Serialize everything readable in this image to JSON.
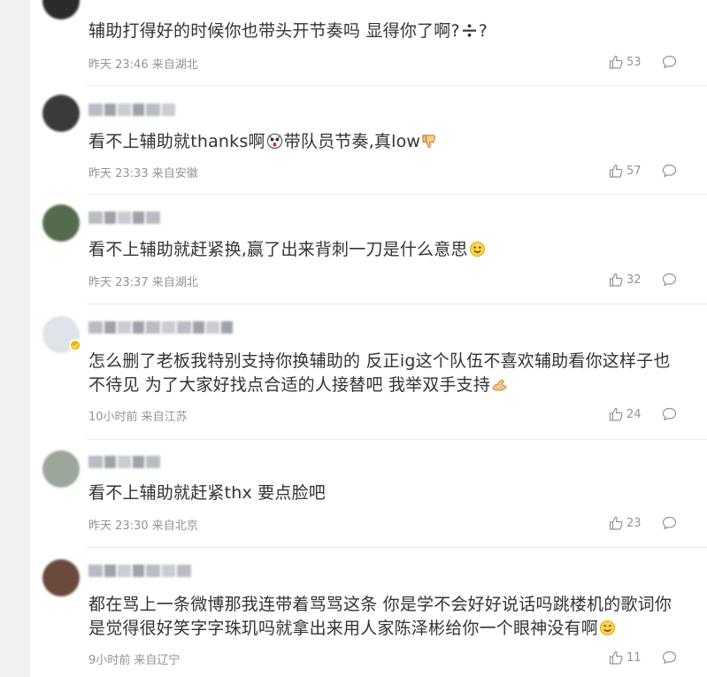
{
  "comments": [
    {
      "text": "辅助打得好的时候你也带头开节奏吗 显得你了啊?",
      "text_suffix": "?",
      "emoji": "divide-emoji",
      "time": "昨天 23:46 来自湖北",
      "likes": "53",
      "avatar_color": "#2b2b2b"
    },
    {
      "text": "看不上辅助就thanks啊",
      "text_mid": "带队员节奏,真low",
      "emoji": "shocked-emoji",
      "emoji2": "thumbs-down-emoji",
      "time": "昨天 23:33 来自安徽",
      "likes": "57",
      "avatar_color": "#3a3a3a"
    },
    {
      "text": "看不上辅助就赶紧换,赢了出来背刺一刀是什么意思",
      "emoji": "smile-emoji",
      "time": "昨天 23:37 来自湖北",
      "likes": "32",
      "avatar_color": "#556b4f"
    },
    {
      "text": "怎么删了老板我特别支持你换辅助的 反正ig这个队伍不喜欢辅助看你这样子也不待见 为了大家好找点合适的人接替吧 我举双手支持",
      "emoji": "flex-emoji",
      "time": "10小时前 来自江苏",
      "likes": "24",
      "avatar_color": "#dfe3ea"
    },
    {
      "text": "看不上辅助就赶紧thx 要点脸吧",
      "time": "昨天 23:30 来自北京",
      "likes": "23",
      "avatar_color": "#9aa79a"
    },
    {
      "text": "都在骂上一条微博那我连带着骂骂这条 你是学不会好好说话吗跳楼机的歌词你是觉得很好笑字字珠玑吗就拿出来用人家陈泽彬给你一个眼神没有啊",
      "emoji": "smile-emoji",
      "time": "9小时前 来自辽宁",
      "likes": "11",
      "avatar_color": "#6b4a3d"
    }
  ],
  "icons": {
    "like": "thumbs-up-icon",
    "reply": "comment-bubble-icon"
  },
  "colors": {
    "text": "#333333",
    "meta": "#939393",
    "divider": "#ececec",
    "verified": "#f6b400"
  }
}
